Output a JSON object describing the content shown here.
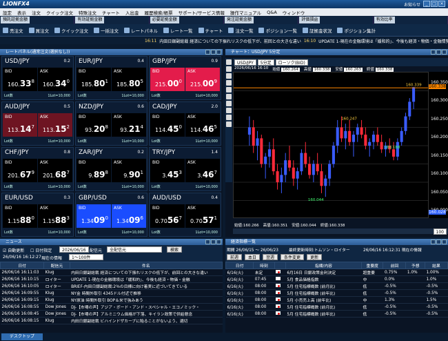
{
  "app": {
    "logo": "LIONFX4",
    "window_title_right": "お知らせ"
  },
  "menu": [
    "設定",
    "表示",
    "注文",
    "クイック注文",
    "特殊注文",
    "チャート",
    "入出金",
    "履歴検索/帳票",
    "サポート/サービス情報",
    "操作マニュアル",
    "Q&A",
    "ウィンドウ"
  ],
  "account": [
    {
      "label": "預託証拠金額",
      "value": ""
    },
    {
      "label": "有効証拠金額",
      "value": ""
    },
    {
      "label": "必要証拠金額",
      "value": ""
    },
    {
      "label": "発注証拠金額",
      "value": ""
    },
    {
      "label": "評価損益",
      "value": ""
    },
    {
      "label": "有効比率",
      "value": ""
    }
  ],
  "toolbar": [
    "売注文",
    "買注文",
    "クイック注文",
    "一括注文",
    "レートパネル",
    "レート一覧",
    "チャート",
    "注文一覧",
    "ポジション一覧",
    "証拠金状況",
    "ポジション集計"
  ],
  "ticker": {
    "time1": "16:11",
    "text1": "内田日銀副総裁 経済についての下振れリスクの低下が、前回との大きな違い",
    "time2": "16:10",
    "text2": "UPDATE 1-現在の金融環境は「緩和的」、今後も経済・物価・金融情勢を"
  },
  "rate_panel": {
    "title": "レートパネル(通常注文(選択なし))",
    "tiles": [
      {
        "pair": "USD/JPY",
        "spread": "0.2",
        "bid": {
          "s": "160.",
          "b": "33",
          "t": "8"
        },
        "ask": {
          "s": "160.",
          "b": "34",
          "t": "0"
        },
        "lot": "1Lot=10,000",
        "hl": ""
      },
      {
        "pair": "EUR/JPY",
        "spread": "0.4",
        "bid": {
          "s": "185.",
          "b": "80",
          "t": "1"
        },
        "ask": {
          "s": "185.",
          "b": "80",
          "t": "5"
        },
        "lot": "1Lot=10,000",
        "hl": ""
      },
      {
        "pair": "GBP/JPY",
        "spread": "0.9",
        "bid": {
          "s": "215.",
          "b": "00",
          "t": "0"
        },
        "ask": {
          "s": "215.",
          "b": "00",
          "t": "9"
        },
        "lot": "1Lot=10,000",
        "hl": "red"
      },
      {
        "pair": "AUD/JPY",
        "spread": "0.5",
        "bid": {
          "s": "113.",
          "b": "14",
          "t": "7"
        },
        "ask": {
          "s": "113.",
          "b": "15",
          "t": "2"
        },
        "lot": "1Lot=10,000",
        "hl": "dred"
      },
      {
        "pair": "NZD/JPY",
        "spread": "0.6",
        "bid": {
          "s": "93.",
          "b": "20",
          "t": "8"
        },
        "ask": {
          "s": "93.",
          "b": "21",
          "t": "4"
        },
        "lot": "1Lot=10,000",
        "hl": ""
      },
      {
        "pair": "CAD/JPY",
        "spread": "2.0",
        "bid": {
          "s": "114.",
          "b": "45",
          "t": "0"
        },
        "ask": {
          "s": "114.",
          "b": "46",
          "t": "5"
        },
        "lot": "1Lot=10,000",
        "hl": ""
      },
      {
        "pair": "CHF/JPY",
        "spread": "0.8",
        "bid": {
          "s": "201.",
          "b": "67",
          "t": "9"
        },
        "ask": {
          "s": "201.",
          "b": "68",
          "t": "7"
        },
        "lot": "1Lot=10,000",
        "hl": ""
      },
      {
        "pair": "ZAR/JPY",
        "spread": "0.2",
        "bid": {
          "s": "9.",
          "b": "89",
          "t": "8"
        },
        "ask": {
          "s": "9.",
          "b": "90",
          "t": "1"
        },
        "lot": "1Lot=10,000",
        "hl": ""
      },
      {
        "pair": "TRY/JPY",
        "spread": "1.4",
        "bid": {
          "s": "3.",
          "b": "45",
          "t": "3"
        },
        "ask": {
          "s": "3.",
          "b": "46",
          "t": "7"
        },
        "lot": "1Lot=10,000",
        "hl": ""
      },
      {
        "pair": "EUR/USD",
        "spread": "0.3",
        "bid": {
          "s": "1.15",
          "b": "88",
          "t": "0"
        },
        "ask": {
          "s": "1.15",
          "b": "88",
          "t": "3"
        },
        "lot": "1Lot=10,000",
        "hl": ""
      },
      {
        "pair": "GBP/USD",
        "spread": "0.6",
        "bid": {
          "s": "1.34",
          "b": "09",
          "t": "0"
        },
        "ask": {
          "s": "1.34",
          "b": "09",
          "t": "6"
        },
        "lot": "1Lot=10,000",
        "hl": "blue"
      },
      {
        "pair": "AUD/USD",
        "spread": "0.4",
        "bid": {
          "s": "0.70",
          "b": "56",
          "t": "7"
        },
        "ask": {
          "s": "0.70",
          "b": "57",
          "t": "1"
        },
        "lot": "1Lot=10,000",
        "hl": ""
      }
    ]
  },
  "chart": {
    "title": "チャート：USD/JPY 5分足",
    "symbol": "USD/JPY",
    "timeframe": "5分足",
    "candle_type": "ローソク(BID)",
    "datetime": "2026/06/16 16:10",
    "open_label": "始値",
    "open": "160.264",
    "high_label": "高値",
    "high": "160.338",
    "low_label": "安値",
    "low": "160.263",
    "close_label": "終値",
    "close": "160.338",
    "ohlc_bottom": {
      "open": "始値:160.266",
      "high": "高値:160.351",
      "low": "安値:160.044",
      "close": "終値:160.338"
    },
    "annotations": [
      "160.247",
      "160.339",
      "160.188",
      "160.044"
    ],
    "zoom": "100",
    "yticks": [
      "160.350",
      "160.300",
      "160.250",
      "160.200",
      "160.150",
      "160.100",
      "160.050",
      "160.000"
    ],
    "current_price": "160.338",
    "tick_last": "160.028"
  },
  "chart_data": {
    "type": "candlestick",
    "y_range": [
      159.98,
      160.38
    ],
    "candles": [
      [
        160.21,
        160.26,
        160.18,
        160.23
      ],
      [
        160.23,
        160.25,
        160.16,
        160.18
      ],
      [
        160.18,
        160.22,
        160.14,
        160.2
      ],
      [
        160.2,
        160.21,
        160.12,
        160.13
      ],
      [
        160.13,
        160.16,
        160.09,
        160.15
      ],
      [
        160.15,
        160.19,
        160.12,
        160.17
      ],
      [
        160.17,
        160.2,
        160.1,
        160.11
      ],
      [
        160.11,
        160.13,
        160.06,
        160.08
      ],
      [
        160.08,
        160.12,
        160.05,
        160.1
      ],
      [
        160.1,
        160.16,
        160.08,
        160.14
      ],
      [
        160.14,
        160.18,
        160.11,
        160.12
      ],
      [
        160.12,
        160.14,
        160.07,
        160.09
      ],
      [
        160.09,
        160.12,
        160.06,
        160.11
      ],
      [
        160.11,
        160.17,
        160.1,
        160.16
      ],
      [
        160.16,
        160.19,
        160.12,
        160.13
      ],
      [
        160.13,
        160.15,
        160.09,
        160.1
      ],
      [
        160.1,
        160.14,
        160.08,
        160.13
      ],
      [
        160.13,
        160.16,
        160.1,
        160.11
      ],
      [
        160.11,
        160.13,
        160.05,
        160.07
      ],
      [
        160.07,
        160.1,
        160.04,
        160.09
      ],
      [
        160.09,
        160.14,
        160.07,
        160.13
      ],
      [
        160.13,
        160.19,
        160.12,
        160.18
      ],
      [
        160.18,
        160.25,
        160.16,
        160.23
      ],
      [
        160.23,
        160.26,
        160.19,
        160.2
      ],
      [
        160.2,
        160.24,
        160.17,
        160.22
      ],
      [
        160.22,
        160.25,
        160.18,
        160.19
      ],
      [
        160.19,
        160.22,
        160.15,
        160.21
      ],
      [
        160.21,
        160.24,
        160.19,
        160.23
      ],
      [
        160.23,
        160.25,
        160.2,
        160.21
      ],
      [
        160.21,
        160.23,
        160.17,
        160.18
      ],
      [
        160.18,
        160.2,
        160.15,
        160.19
      ],
      [
        160.19,
        160.22,
        160.17,
        160.21
      ],
      [
        160.21,
        160.23,
        160.18,
        160.19
      ],
      [
        160.19,
        160.21,
        160.16,
        160.17
      ],
      [
        160.17,
        160.19,
        160.15,
        160.18
      ],
      [
        160.18,
        160.2,
        160.16,
        160.17
      ],
      [
        160.17,
        160.19,
        160.14,
        160.15
      ],
      [
        160.15,
        160.2,
        160.14,
        160.19
      ],
      [
        160.19,
        160.23,
        160.18,
        160.22
      ],
      [
        160.22,
        160.27,
        160.21,
        160.26
      ],
      [
        160.26,
        160.31,
        160.25,
        160.3
      ],
      [
        160.3,
        160.34,
        160.28,
        160.34
      ]
    ]
  },
  "news": {
    "title": "ニュース",
    "auto_update": "自動更新",
    "date_filter": "日付指定",
    "date_value": "2026/06/16",
    "source_label": "配信元",
    "source_value": "全配信元",
    "search": "検索",
    "date_to": "26/06/16 16:12:27",
    "status": "現在の情報",
    "count_value": "1〜100件",
    "headers": [
      "日付",
      "配信元",
      "件名"
    ],
    "rows": [
      [
        "26/06/16 16:11:03",
        "Klug",
        "内田日銀副総裁 経済についての下振れリスクの低下が、前回との大きな違い"
      ],
      [
        "26/06/16 16:10:15",
        "ロイター",
        "UPDATE 1-現在の金融環境は「緩和的」、今後も経済・物価・金融"
      ],
      [
        "26/06/16 16:10:05",
        "ロイター",
        "BRIEF-内田日銀副総裁:2％の目標に向け着実に近づいてきている"
      ],
      [
        "26/06/16 16:09:55",
        "Klug",
        "NY金 時間外取引 4345ドル付近で推移"
      ],
      [
        "26/06/16 16:09:15",
        "Klug",
        "NY原油 時間外取引 BOP＆米で強みあう"
      ],
      [
        "26/06/16 16:08:55",
        "Dow Jones",
        "DJ-【市場の声】アジア・ボード・アンド・スペシャル・エコノミック・"
      ],
      [
        "26/06/16 16:08:45",
        "Dow Jones",
        "DJ-【市場の声】アルミニウム価格が下落、キイラン政策で供給懸念"
      ],
      [
        "26/06/16 16:08:15",
        "Klug",
        "内田日銀副総裁 ビハインドザカーブに陥ることがないよう、適切"
      ]
    ]
  },
  "econ": {
    "title": "経済指標一覧",
    "period": "期間 26/06/15 〜 26/06/23",
    "update": "最終更新時刻:トムソン・ロイター",
    "updated_at": "26/06/16 16:12:31 現在の情報",
    "btns": [
      "前週",
      "本日",
      "翌週",
      "条件変更",
      "更新"
    ],
    "headers": [
      "日付",
      "時刻",
      "",
      "指標/内容",
      "重要度",
      "前回",
      "予想",
      "結果"
    ],
    "rows": [
      [
        "6/16(火)",
        "未定",
        "jp",
        "6月16日 日銀政策金利決定",
        "超重要",
        "0.75%",
        "1.0%",
        "1.00%"
      ],
      [
        "6/16(火)",
        "07:45",
        "nz",
        "5月 食品価格指数",
        "中",
        "0.0%",
        "",
        "1.0%"
      ],
      [
        "6/16(火)",
        "08:00",
        "jp",
        "5月 住宅指標概数 (前月比)",
        "低",
        "-0.5%",
        "",
        "-0.5%"
      ],
      [
        "6/16(火)",
        "08:00",
        "jp",
        "5月 住宅指標概数 (前年比)",
        "低",
        "-0.5%",
        "",
        "-0.5%"
      ],
      [
        "6/16(火)",
        "08:00",
        "jp",
        "5月 小売売上高 (前年比)",
        "中",
        "1.3%",
        "",
        "1.5%"
      ],
      [
        "6/16(火)",
        "08:00",
        "jp",
        "5月 住宅指標概数 (前月比)",
        "低",
        "-0.5%",
        "",
        "-0.5%"
      ],
      [
        "6/16(火)",
        "08:00",
        "jp",
        "5月 住宅指標概数 (前年比)",
        "低",
        "-0.5%",
        "",
        "-0.5%"
      ]
    ]
  },
  "status": {
    "tab": "デスクトップ"
  },
  "colors": {
    "bg": "#0a1a2e",
    "red": "#e31c4b",
    "blue": "#1a4dff",
    "candle_up": "#3a5cff",
    "candle_down": "#ff2a3a"
  }
}
